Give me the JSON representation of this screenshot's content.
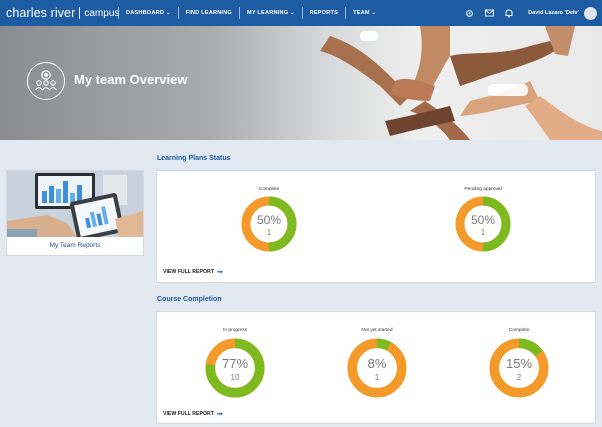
{
  "brand": {
    "logo": "charles river",
    "sub": "campus"
  },
  "nav": [
    {
      "label": "DASHBOARD",
      "caret": "⌄"
    },
    {
      "label": "FIND LEARNING",
      "caret": ""
    },
    {
      "label": "MY LEARNING",
      "caret": "⌄"
    },
    {
      "label": "REPORTS",
      "caret": ""
    },
    {
      "label": "TEAM",
      "caret": "⌄"
    }
  ],
  "user": {
    "name": "David Lazaro 'Delv'"
  },
  "hero": {
    "title": "My team Overview"
  },
  "reports_card": {
    "label": "My Team Reports"
  },
  "learning_plans": {
    "title": "Learning Plans Status",
    "link": "VIEW FULL REPORT",
    "charts": [
      {
        "label": "Complete",
        "pct": "50%",
        "count": "1",
        "fraction": 0.5
      },
      {
        "label": "Pending approval",
        "pct": "50%",
        "count": "1",
        "fraction": 0.5
      }
    ]
  },
  "course_completion": {
    "title": "Course Completion",
    "link": "VIEW FULL REPORT",
    "charts": [
      {
        "label": "In progress",
        "pct": "77%",
        "count": "10",
        "fraction": 0.77
      },
      {
        "label": "Not yet started",
        "pct": "8%",
        "count": "1",
        "fraction": 0.08
      },
      {
        "label": "Complete",
        "pct": "15%",
        "count": "2",
        "fraction": 0.15
      }
    ]
  },
  "colors": {
    "green": "#7cba1f",
    "orange": "#f39a2b",
    "nav": "#1d5ba3"
  }
}
